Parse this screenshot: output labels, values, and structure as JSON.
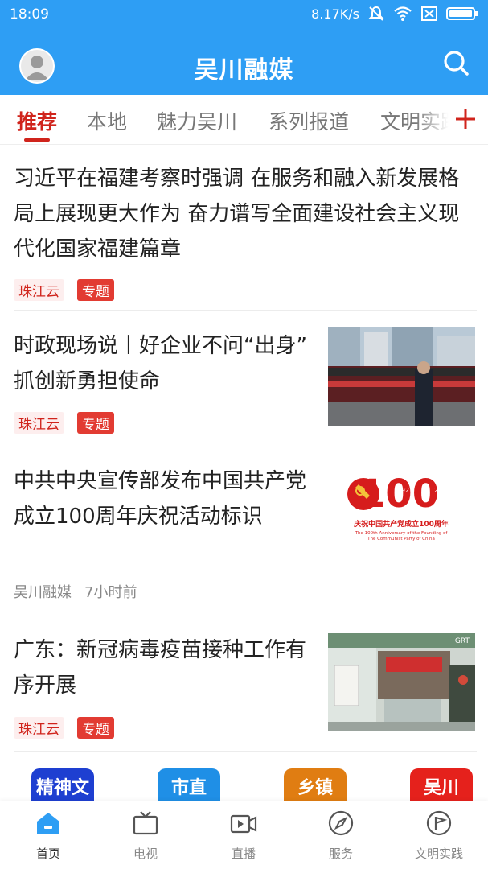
{
  "status_bar": {
    "time": "18:09",
    "net_speed": "8.17K/s",
    "icons": [
      "mute-icon",
      "wifi-icon",
      "sim-icon",
      "battery-icon"
    ]
  },
  "header": {
    "title": "吴川融媒",
    "bg_color": "#2e9ef4"
  },
  "tabs": {
    "items": [
      "推荐",
      "本地",
      "魅力吴川",
      "系列报道",
      "文明实践"
    ],
    "active_index": 0,
    "accent_color": "#d0241c"
  },
  "feed": [
    {
      "title": "习近平在福建考察时强调 在服务和融入新发展格局上展现更大作为 奋力谱写全面建设社会主义现代化国家福建篇章",
      "source": "珠江云",
      "badge": "专题"
    },
    {
      "title": "时政现场说丨好企业不问“出身” 抓创新勇担使命",
      "source": "珠江云",
      "badge": "专题"
    },
    {
      "title": "中共中央宣传部发布中国共产党成立100周年庆祝活动标识",
      "source": "吴川融媒",
      "time": "7小时前",
      "logo": {
        "number": "100",
        "year_start": "1921",
        "year_end": "2021",
        "caption_cn": "庆祝中国共产党成立100周年",
        "caption_en_1": "The 100th Anniversary of the Founding of",
        "caption_en_2": "The Communist Party of China"
      }
    },
    {
      "title": "广东：新冠病毒疫苗接种工作有序开展",
      "source": "珠江云",
      "badge": "专题",
      "watermark": "GRT"
    }
  ],
  "quick_entries": [
    {
      "label": "精神文",
      "color": "#1e3fd1"
    },
    {
      "label": "市直",
      "color": "#1f8fe6"
    },
    {
      "label": "乡镇",
      "color": "#e07d12"
    },
    {
      "label": "吴川",
      "color": "#e5211c"
    }
  ],
  "bottom_nav": {
    "items": [
      "首页",
      "电视",
      "直播",
      "服务",
      "文明实践"
    ],
    "active_index": 0,
    "active_color": "#2e9ef4"
  }
}
